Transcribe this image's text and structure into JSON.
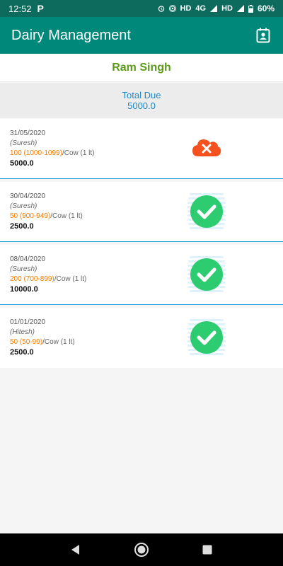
{
  "status_bar": {
    "time": "12:52",
    "network": "HD",
    "network2": "4G",
    "network3": "HD",
    "battery": "60%"
  },
  "app_bar": {
    "title": "Dairy Management",
    "action_icon": "calendar-contact-icon"
  },
  "customer": {
    "name": "Ram Singh"
  },
  "due": {
    "label": "Total Due",
    "amount": "5000.0"
  },
  "entries": [
    {
      "date": "31/05/2020",
      "agent": "(Suresh)",
      "qty_range": "100 (1000-1099)",
      "unit": "/Cow (1 lt)",
      "amount": "5000.0",
      "status": "failed"
    },
    {
      "date": "30/04/2020",
      "agent": "(Suresh)",
      "qty_range": "50 (900-949)",
      "unit": "/Cow (1 lt)",
      "amount": "2500.0",
      "status": "paid"
    },
    {
      "date": "08/04/2020",
      "agent": "(Suresh)",
      "qty_range": "200 (700-899)",
      "unit": "/Cow (1 lt)",
      "amount": "10000.0",
      "status": "paid"
    },
    {
      "date": "01/01/2020",
      "agent": "(Hitesh)",
      "qty_range": "50 (50-99)",
      "unit": "/Cow (1 lt)",
      "amount": "2500.0",
      "status": "paid"
    }
  ],
  "colors": {
    "app_bar": "#00897b",
    "status_bar": "#0d6b5e",
    "customer_name": "#5c9a1b",
    "due_text": "#1e88c9",
    "range_text": "#f57c00",
    "paid": "#2ecc71",
    "failed": "#f4511e"
  }
}
